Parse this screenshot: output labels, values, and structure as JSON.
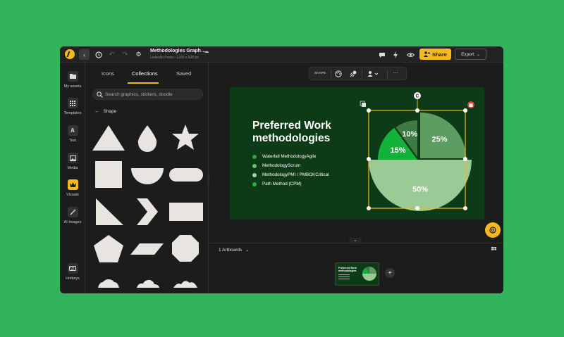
{
  "topbar": {
    "doc_title": "Methodologies Graph…",
    "doc_subtitle": "LinkedIn Posts • 1200 x 628 px",
    "share_label": "Share",
    "export_label": "Export",
    "icons": [
      "logo",
      "back-icon",
      "history-icon",
      "undo-icon",
      "redo-icon",
      "settings-icon",
      "cloud-icon",
      "comment-icon",
      "bolt-icon",
      "preview-eye-icon",
      "add-user-icon",
      "chevron-down-icon"
    ]
  },
  "rail": {
    "items": [
      {
        "label": "My assets",
        "icon": "folder-icon"
      },
      {
        "label": "Templates",
        "icon": "templates-grid-icon"
      },
      {
        "label": "Text",
        "icon": "text-icon"
      },
      {
        "label": "Media",
        "icon": "media-icon"
      },
      {
        "label": "Visuals",
        "icon": "crown-icon"
      },
      {
        "label": "AI Images",
        "icon": "magic-wand-icon"
      },
      {
        "label": "Hotkeys",
        "icon": "keyboard-icon"
      }
    ]
  },
  "panel": {
    "tabs": [
      "Icons",
      "Collections",
      "Saved"
    ],
    "active_tab": "Collections",
    "search_placeholder": "Search graphics, stickers, doodle",
    "section_title": "Shape",
    "shape_color": "#e8e4e0"
  },
  "context_toolbar": {
    "shape_label": "SHAPE"
  },
  "canvas": {
    "heading": "Preferred Work methodologies",
    "bullets": [
      {
        "text": "Waterfall MethodologyAgile",
        "color": "#3a9c46"
      },
      {
        "text": "MethodologyScrum",
        "color": "#6fbf6f"
      },
      {
        "text": "MethodologyPMI / PMBOKCritical",
        "color": "#9fd49a"
      },
      {
        "text": "Path Method (CPM)",
        "color": "#1fb53f"
      }
    ],
    "pie": {
      "slices": [
        {
          "label": "25%",
          "value": 25,
          "color": "#5e9d62"
        },
        {
          "label": "50%",
          "value": 50,
          "color": "#9acb96"
        },
        {
          "label": "15%",
          "value": 15,
          "color": "#13b23a"
        },
        {
          "label": "10%",
          "value": 10,
          "color": "#3f7a44"
        }
      ]
    },
    "selection_color": "#f5b91e",
    "rotate_glyph": "C"
  },
  "artboards": {
    "label": "1 Artboards"
  },
  "thumbnail": {
    "title": "Preferred Work methodologies"
  },
  "colors": {
    "accent": "#f5b91e",
    "background": "#33b35b",
    "canvas": "#0d3b18"
  }
}
